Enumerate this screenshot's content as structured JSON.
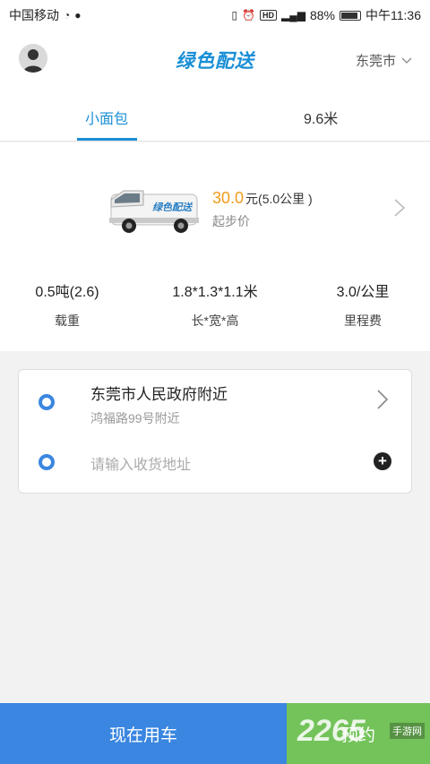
{
  "status_bar": {
    "carrier": "中国移动",
    "battery": "88%",
    "time": "中午11:36",
    "icons": [
      "hotspot-icon",
      "wechat-icon",
      "vibrate-icon",
      "alarm-icon",
      "hd-icon",
      "signal-4g-icon",
      "battery-icon"
    ]
  },
  "header": {
    "brand": "绿色配送",
    "city": "东莞市"
  },
  "tabs": [
    {
      "label": "小面包",
      "active": true
    },
    {
      "label": "9.6米",
      "active": false
    }
  ],
  "vehicle": {
    "van_text": "绿色配送",
    "price": "30.0",
    "price_unit": "元",
    "price_note": "(5.0公里 )",
    "base_label": "起步价",
    "specs": [
      {
        "value": "0.5吨(2.6)",
        "label": "载重"
      },
      {
        "value": "1.8*1.3*1.1米",
        "label": "长*宽*高"
      },
      {
        "value": "3.0/公里",
        "label": "里程费"
      }
    ]
  },
  "address": {
    "origin_title": "东莞市人民政府附近",
    "origin_sub": "鸿福路99号附近",
    "destination_placeholder": "请输入收货地址"
  },
  "bottom": {
    "now_label": "现在用车",
    "book_label": "预约",
    "watermark": "2265",
    "watermark_sub": "手游网"
  },
  "colors": {
    "accent": "#1a8fd6",
    "primary_button": "#3a86e0",
    "secondary_button": "#73c35a",
    "price": "#f39b1b"
  }
}
